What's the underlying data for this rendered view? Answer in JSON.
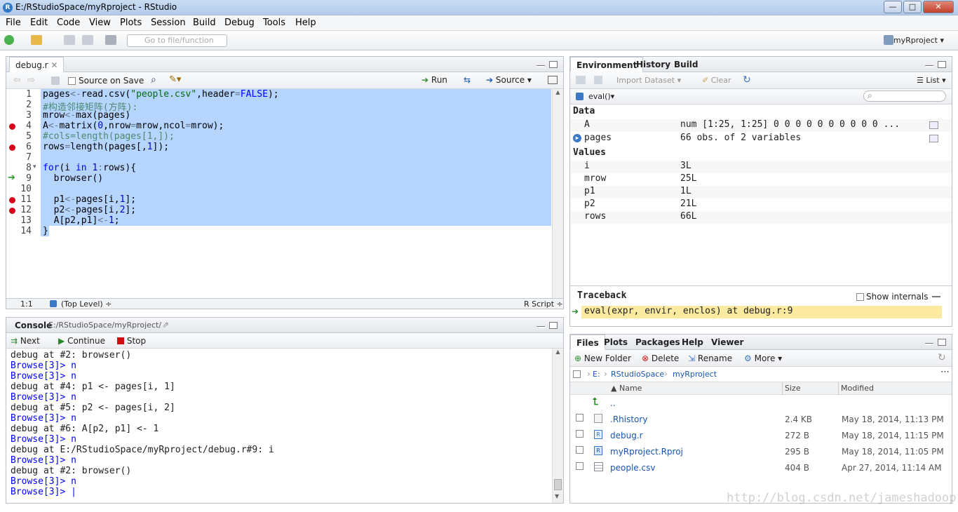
{
  "window": {
    "title": "E:/RStudioSpace/myRproject - RStudio",
    "minimize": "—",
    "maximize": "□",
    "close": "✕"
  },
  "menu": [
    "File",
    "Edit",
    "Code",
    "View",
    "Plots",
    "Session",
    "Build",
    "Debug",
    "Tools",
    "Help"
  ],
  "toolbar": {
    "goto_placeholder": "Go to file/function",
    "project": "myRproject"
  },
  "editor": {
    "tab": "debug.r",
    "source_on_save": "Source on Save",
    "run": "Run",
    "source": "Source",
    "lines": [
      {
        "n": "1",
        "code": "pages<-read.csv(\"people.csv\",header=FALSE);"
      },
      {
        "n": "2",
        "code": "#构造邻接矩阵(方阵):"
      },
      {
        "n": "3",
        "code": "mrow<-max(pages)"
      },
      {
        "n": "4",
        "code": "A<-matrix(0,nrow=mrow,ncol=mrow);",
        "bp": true
      },
      {
        "n": "5",
        "code": "#cols=length(pages[1,]);"
      },
      {
        "n": "6",
        "code": "rows=length(pages[,1]);",
        "bp": true
      },
      {
        "n": "7",
        "code": ""
      },
      {
        "n": "8",
        "code": "for(i in 1:rows){"
      },
      {
        "n": "9",
        "code": "  browser()",
        "arrow": true
      },
      {
        "n": "10",
        "code": ""
      },
      {
        "n": "11",
        "code": "  p1<-pages[i,1];",
        "bp": true
      },
      {
        "n": "12",
        "code": "  p2<-pages[i,2];",
        "bp": true
      },
      {
        "n": "13",
        "code": "  A[p2,p1]<-1;"
      },
      {
        "n": "14",
        "code": "}"
      }
    ],
    "status_pos": "1:1",
    "status_scope": "(Top Level) ÷",
    "status_type": "R Script ÷"
  },
  "console": {
    "title": "Console",
    "path": "E:/RStudioSpace/myRproject/",
    "next": "Next",
    "continue": "Continue",
    "stop": "Stop",
    "lines": [
      {
        "t": "debug at #2: browser()"
      },
      {
        "t": "Browse[3]> n",
        "p": true
      },
      {
        "t": "Browse[3]> n",
        "p": true
      },
      {
        "t": "debug at #4: p1 <- pages[i, 1]"
      },
      {
        "t": "Browse[3]> n",
        "p": true
      },
      {
        "t": "debug at #5: p2 <- pages[i, 2]"
      },
      {
        "t": "Browse[3]> n",
        "p": true
      },
      {
        "t": "debug at #6: A[p2, p1] <- 1"
      },
      {
        "t": "Browse[3]> n",
        "p": true
      },
      {
        "t": "debug at E:/RStudioSpace/myRproject/debug.r#9: i"
      },
      {
        "t": "Browse[3]> n",
        "p": true
      },
      {
        "t": "debug at #2: browser()"
      },
      {
        "t": "Browse[3]> n",
        "p": true
      },
      {
        "t": "Browse[3]> |",
        "p": true
      }
    ]
  },
  "environment": {
    "tabs": [
      "Environment",
      "History",
      "Build"
    ],
    "import_dataset": "Import Dataset",
    "clear": "Clear",
    "list": "List",
    "scope": "eval()",
    "data_label": "Data",
    "data": [
      {
        "name": "A",
        "value": "num [1:25, 1:25] 0 0 0 0 0 0 0 0 0 0 ..."
      },
      {
        "name": "pages",
        "value": "66 obs. of 2 variables"
      }
    ],
    "values_label": "Values",
    "values": [
      {
        "name": "i",
        "value": "3L"
      },
      {
        "name": "mrow",
        "value": "25L"
      },
      {
        "name": "p1",
        "value": "1L"
      },
      {
        "name": "p2",
        "value": "21L"
      },
      {
        "name": "rows",
        "value": "66L"
      }
    ],
    "traceback": "Traceback",
    "show_internals": "Show internals",
    "trace": "eval(expr, envir, enclos) at debug.r:9"
  },
  "files": {
    "tabs": [
      "Files",
      "Plots",
      "Packages",
      "Help",
      "Viewer"
    ],
    "new_folder": "New Folder",
    "delete": "Delete",
    "rename": "Rename",
    "more": "More",
    "breadcrumb": [
      "E:",
      "RStudioSpace",
      "myRproject"
    ],
    "col_name": "Name",
    "col_size": "Size",
    "col_modified": "Modified",
    "up": "..",
    "rows": [
      {
        "name": ".Rhistory",
        "size": "2.4 KB",
        "modified": "May 18, 2014, 11:13 PM"
      },
      {
        "name": "debug.r",
        "size": "272 B",
        "modified": "May 18, 2014, 11:15 PM"
      },
      {
        "name": "myRproject.Rproj",
        "size": "295 B",
        "modified": "May 18, 2014, 11:05 PM"
      },
      {
        "name": "people.csv",
        "size": "404 B",
        "modified": "Apr 27, 2014, 11:14 AM"
      }
    ]
  },
  "watermark": "http://blog.csdn.net/jameshadoop"
}
